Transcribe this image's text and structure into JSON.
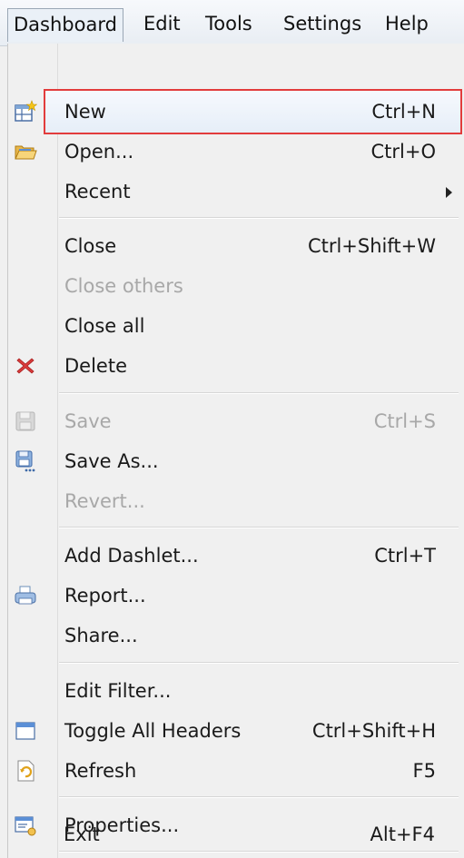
{
  "menubar": {
    "items": [
      "Dashboard",
      "Edit",
      "Tools",
      "Settings",
      "Help"
    ]
  },
  "menu": {
    "new": {
      "label": "New",
      "shortcut": "Ctrl+N",
      "icon": "new-dashboard-icon"
    },
    "open": {
      "label": "Open...",
      "shortcut": "Ctrl+O",
      "icon": "folder-open-icon"
    },
    "recent": {
      "label": "Recent"
    },
    "close": {
      "label": "Close",
      "shortcut": "Ctrl+Shift+W"
    },
    "close_others": {
      "label": "Close others"
    },
    "close_all": {
      "label": "Close all"
    },
    "delete": {
      "label": "Delete",
      "icon": "delete-x-icon"
    },
    "save": {
      "label": "Save",
      "shortcut": "Ctrl+S",
      "icon": "save-disk-icon"
    },
    "save_as": {
      "label": "Save As...",
      "icon": "save-as-icon"
    },
    "revert": {
      "label": "Revert..."
    },
    "add_dashlet": {
      "label": "Add Dashlet...",
      "shortcut": "Ctrl+T"
    },
    "report": {
      "label": "Report...",
      "icon": "report-icon"
    },
    "share": {
      "label": "Share..."
    },
    "edit_filter": {
      "label": "Edit Filter..."
    },
    "toggle_headers": {
      "label": "Toggle All Headers",
      "shortcut": "Ctrl+Shift+H",
      "icon": "window-header-icon"
    },
    "refresh": {
      "label": "Refresh",
      "shortcut": "F5",
      "icon": "refresh-icon"
    },
    "properties": {
      "label": "Properties...",
      "icon": "properties-icon"
    },
    "exit": {
      "label": "Exit",
      "shortcut": "Alt+F4"
    }
  },
  "colors": {
    "highlight_border": "#e23c3c",
    "delete_icon": "#d93a3a",
    "disabled_text": "#a8a8a8"
  }
}
